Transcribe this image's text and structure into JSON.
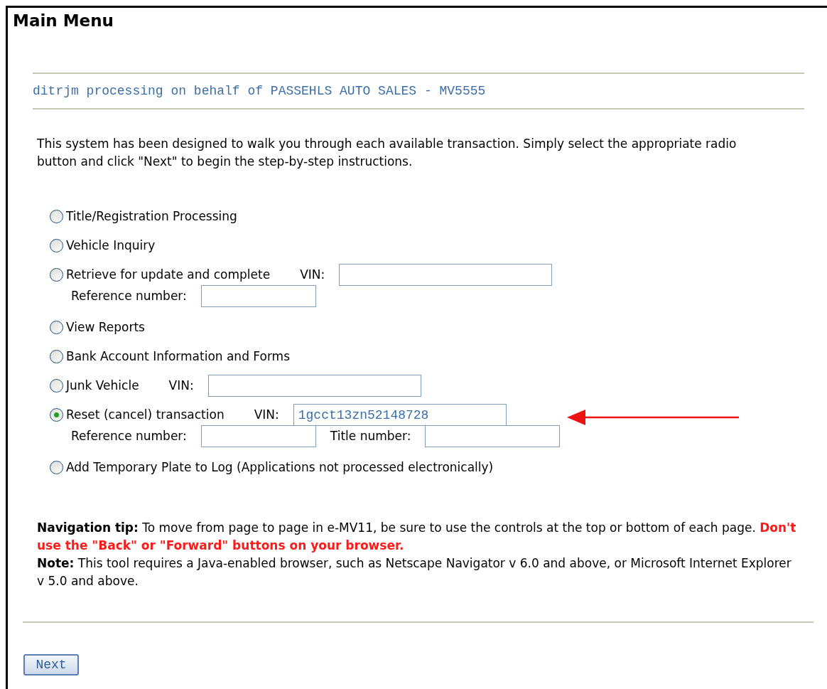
{
  "title": "Main Menu",
  "banner": "ditrjm processing on behalf of PASSEHLS AUTO SALES - MV5555",
  "intro": "This system has been designed to walk you through each available transaction. Simply select the appropriate radio button and click \"Next\" to begin the step-by-step instructions.",
  "options": [
    {
      "label": "Title/Registration Processing",
      "selected": false
    },
    {
      "label": "Vehicle Inquiry",
      "selected": false
    },
    {
      "label": "Retrieve for update and complete",
      "selected": false,
      "fields": [
        {
          "kind": "vin",
          "label": "VIN:"
        }
      ],
      "second_line_fields": [
        {
          "kind": "reference",
          "label": "Reference number:"
        }
      ]
    },
    {
      "label": "View Reports",
      "selected": false
    },
    {
      "label": "Bank Account Information and Forms",
      "selected": false
    },
    {
      "label": "Junk Vehicle",
      "selected": false,
      "fields": [
        {
          "kind": "vin",
          "label": "VIN:"
        }
      ]
    },
    {
      "label": "Reset (cancel) transaction",
      "selected": true,
      "fields": [
        {
          "kind": "vin",
          "label": "VIN:",
          "value": "1gcct13zn52148728"
        }
      ],
      "second_line_fields": [
        {
          "kind": "reference",
          "label": "Reference number:"
        },
        {
          "kind": "title",
          "label": "Title number:"
        }
      ]
    },
    {
      "label": "Add Temporary Plate to Log (Applications not processed electronically)",
      "selected": false
    }
  ],
  "notes": [
    {
      "text": "**Navigation tip:** To move from page to page in e-MV11, be sure to use the controls at the top or bottom of each page.",
      "warning": "Don't use the \"Back\" or \"Forward\" buttons on your browser."
    },
    {
      "text": "**Note:** This tool requires a Java-enabled browser, such as Netscape Navigator v 6.0 and above, or Microsoft Internet Explorer v 5.0 and above."
    }
  ],
  "next_button": "Next"
}
